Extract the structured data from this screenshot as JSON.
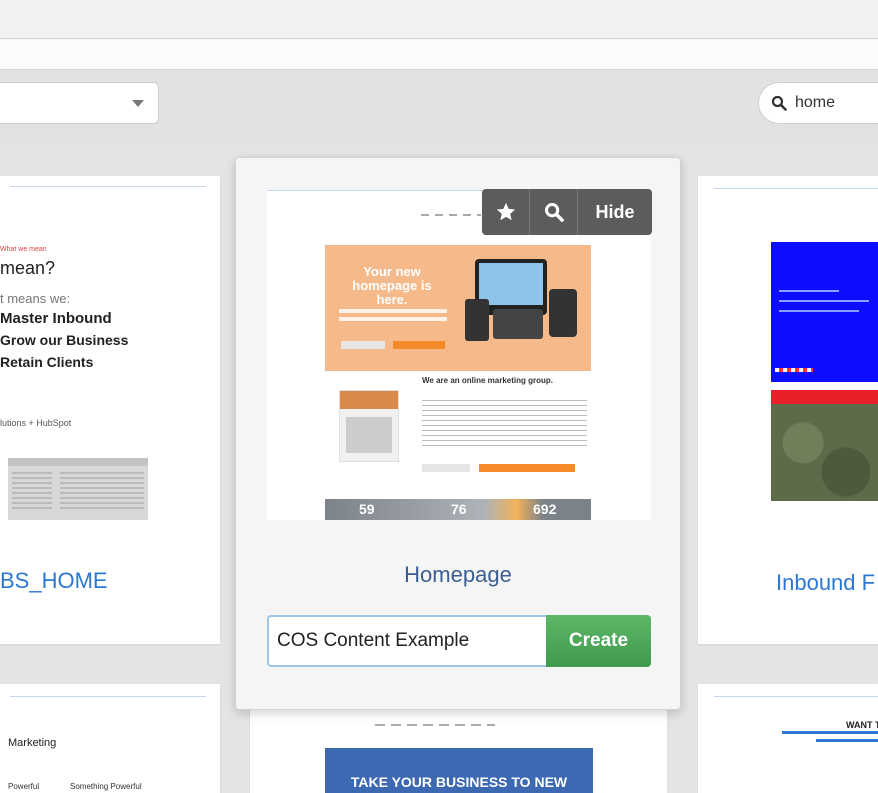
{
  "search": {
    "value": "home"
  },
  "left_card": {
    "tag": "What we mean",
    "heading": "mean?",
    "subheading": "t means we:",
    "bullets": [
      "Master Inbound",
      "Grow our Business",
      "Retain Clients"
    ],
    "partner": "lutions + HubSpot",
    "title": "BS_HOME"
  },
  "featured": {
    "actions": {
      "hide_label": "Hide"
    },
    "preview": {
      "hero_line1": "Your new",
      "hero_line2": "homepage is here.",
      "section_heading": "We are an online marketing group.",
      "stats": [
        "59",
        "76",
        "692"
      ]
    },
    "title": "Homepage",
    "name_input_value": "COS Content Example",
    "create_label": "Create"
  },
  "right_card": {
    "title": "Inbound F"
  },
  "bottom_left": {
    "heading": "Marketing",
    "col1": "Powerful",
    "col2": "Something Powerful"
  },
  "bottom_middle": {
    "banner": "TAKE YOUR BUSINESS TO NEW"
  },
  "bottom_right": {
    "heading": "WANT T"
  },
  "colors": {
    "accent_blue": "#2e77d0",
    "create_green": "#4aa656",
    "hero_orange": "#f6b98a",
    "stats_bar": "#7c8289"
  }
}
